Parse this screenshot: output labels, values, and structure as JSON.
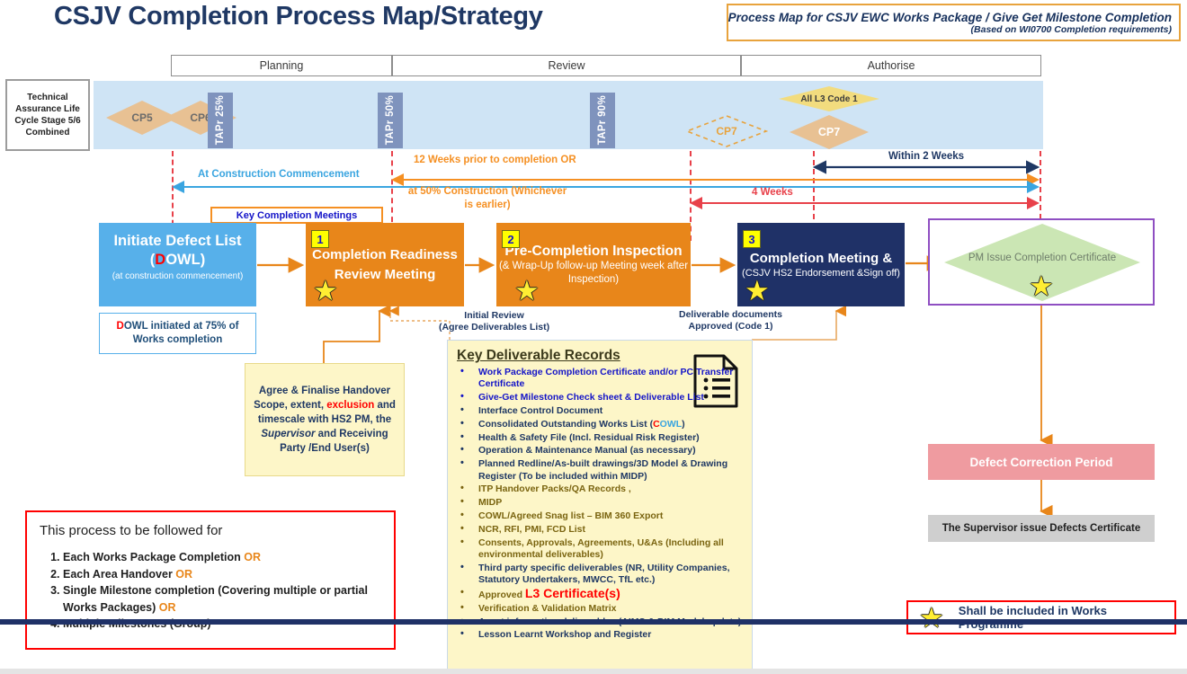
{
  "page_title": "CSJV Completion Process Map/Strategy",
  "subtitle": {
    "line1": "Process Map for CSJV  EWC Works Package / Give Get Milestone Completion",
    "line2": "(Based on WI0700 Completion requirements)"
  },
  "phases": [
    {
      "label": "Planning"
    },
    {
      "label": "Review"
    },
    {
      "label": "Authorise"
    }
  ],
  "assurance_band": {
    "side_label": "Technical Assurance Life Cycle Stage 5/6 Combined",
    "gates": [
      {
        "label": "CP5",
        "style": "solid"
      },
      {
        "label": "CP6",
        "style": "solid"
      },
      {
        "label": "CP7",
        "style": "dashed"
      },
      {
        "label": "CP7",
        "style": "solid"
      }
    ],
    "all_l3": "All L3 Code 1",
    "tapr": [
      {
        "label": "TAPr 25%"
      },
      {
        "label": "TAPr 50%"
      },
      {
        "label": "TAPr 90%"
      }
    ]
  },
  "timeline": {
    "at_construction_commencement": "At Construction Commencement",
    "twelve_weeks": "12 Weeks prior to completion OR",
    "fifty_percent": "at 50% Construction (Whichever is earlier)",
    "within_2_weeks": "Within 2 Weeks",
    "four_weeks": "4 Weeks",
    "key_completion_meetings": "Key Completion Meetings"
  },
  "process": {
    "dowl": {
      "title_a": "Initiate Defect List",
      "title_b_open": "(",
      "title_b_d": "D",
      "title_b_rest": "OWL)",
      "sub": "(at construction commencement)",
      "note_d": "D",
      "note_rest": "OWL initiated at 75% of Works completion"
    },
    "steps": [
      {
        "num": "1",
        "title": "Completion Readiness  Review Meeting",
        "sub": "",
        "star": true
      },
      {
        "num": "2",
        "title": "Pre-Completion Inspection",
        "sub": "(& Wrap-Up follow-up Meeting  week after Inspection)",
        "star": true
      },
      {
        "num": "3",
        "title": "Completion Meeting &",
        "sub": "(CSJV HS2 Endorsement &Sign off)",
        "star": true
      }
    ],
    "pm_decision": "PM Issue Completion Certificate",
    "defect_correction_period": "Defect Correction Period",
    "supervisor_defects_certificate": "The Supervisor issue Defects Certificate",
    "annotation_initial_review": "Initial Review\n(Agree Deliverables List)",
    "annotation_initial_review_l1": "Initial Review",
    "annotation_initial_review_l2": "(Agree Deliverables List)",
    "annotation_deliverables_l1": "Deliverable documents",
    "annotation_deliverables_l2": "Approved (Code 1)"
  },
  "handover_note": {
    "p1": "Agree & Finalise Handover Scope, extent, ",
    "exclusion": "exclusion",
    "p2": " and timescale with HS2 PM, the ",
    "supervisor": "Supervisor",
    "p3": " and Receiving Party /End User(s)"
  },
  "key_deliverable_records": {
    "title": "Key Deliverable Records",
    "items": [
      {
        "text": "Work Package Completion Certificate and/or PC Transfer Certificate",
        "color": "blue"
      },
      {
        "text": "Give-Get Milestone Check sheet & Deliverable List",
        "color": "blue"
      },
      {
        "text": "Interface Control Document",
        "color": "navy"
      },
      {
        "text": "Consolidated Outstanding Works List (COWL)",
        "color": "navy",
        "cowl": true
      },
      {
        "text": "Health & Safety File (Incl. Residual Risk Register)",
        "color": "navy"
      },
      {
        "text": "Operation & Maintenance Manual (as necessary)",
        "color": "navy"
      },
      {
        "text": "Planned Redline/As-built drawings/3D Model & Drawing Register (To be included within MIDP)",
        "color": "navy"
      },
      {
        "text": "ITP Handover Packs/QA Records ,",
        "color": "olive"
      },
      {
        "text": "MIDP",
        "color": "olive"
      },
      {
        "text": "COWL/Agreed Snag list – BIM 360 Export",
        "color": "olive"
      },
      {
        "text": "NCR, RFI, PMI, FCD List",
        "color": "olive"
      },
      {
        "text": "Consents, Approvals, Agreements, U&As (Including all environmental deliverables)",
        "color": "olive"
      },
      {
        "text": "Third party specific deliverables (NR, Utility Companies, Statutory Undertakers, MWCC, TfL etc.)",
        "color": "navy"
      },
      {
        "text": "Approved L3 Certificate(s)",
        "color": "olive",
        "l3": true,
        "approved_prefix": "Approved ",
        "l3_text": "L3 Certificate(s)"
      },
      {
        "text": "Verification & Validation Matrix",
        "color": "olive"
      },
      {
        "text": "Asset information deliverables (AIMS & BIM Model update)",
        "color": "navy"
      },
      {
        "text": "Lesson Learnt Workshop and Register",
        "color": "navy"
      }
    ]
  },
  "process_followed_for": {
    "heading": "This process to be followed for",
    "items": [
      {
        "text": "Each Works Package Completion ",
        "or": "OR"
      },
      {
        "text": "Each Area Handover ",
        "or": "OR"
      },
      {
        "text": "Single Milestone completion (Covering multiple or partial Works Packages) ",
        "or": "OR"
      },
      {
        "text": "Multiple Milestones (Group)",
        "or": ""
      }
    ]
  },
  "legend": {
    "star_icon": "star-icon",
    "text": "Shall be included in Works Programme"
  },
  "colors": {
    "title_navy": "#1f3864",
    "band_blue": "#cfe4f5",
    "orange": "#e8861a",
    "navy_box": "#1f3167",
    "light_blue_box": "#57b0ea",
    "green_diamond": "#cbe6b4",
    "pink": "#ef9ba0",
    "grey": "#cfcfcf",
    "accent_orange": "#f59023",
    "red": "#ff0000",
    "yellow_note": "#fdf6c8"
  }
}
